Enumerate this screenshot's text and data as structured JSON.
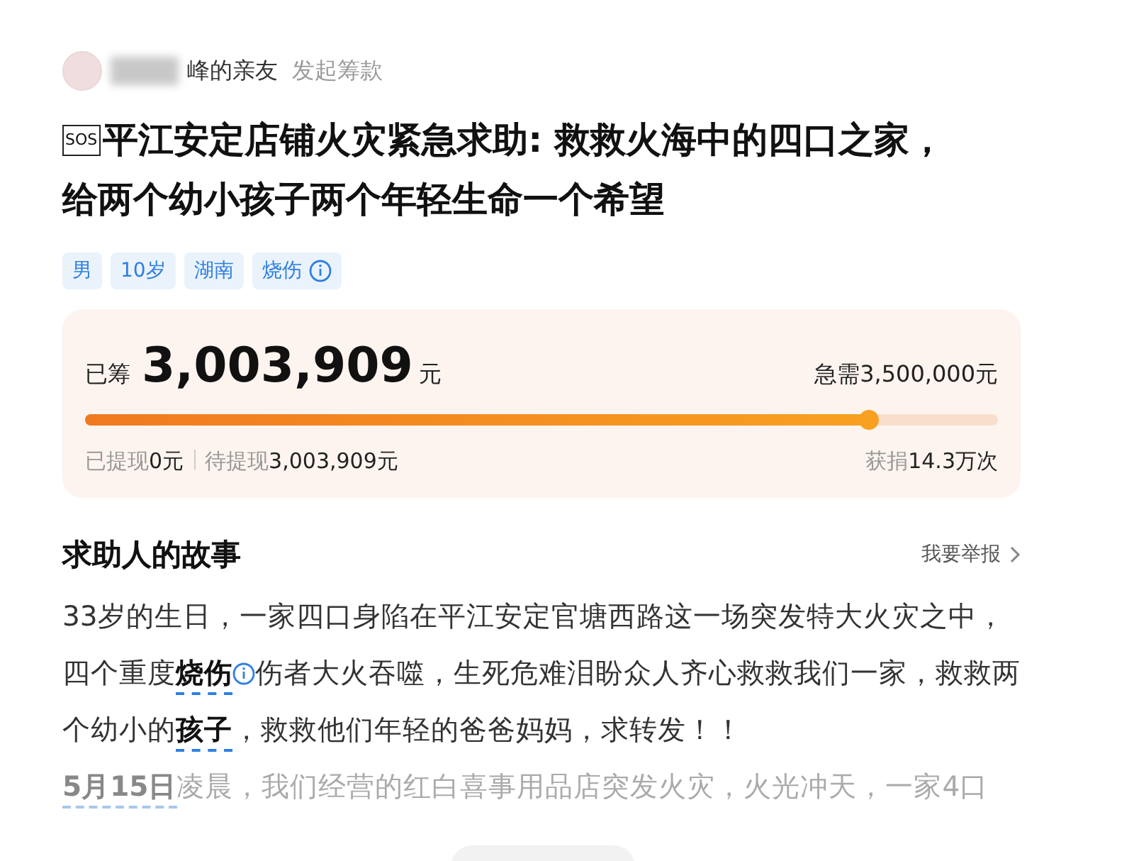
{
  "organizer": {
    "name": "峰的亲友",
    "action": "发起筹款"
  },
  "title": {
    "badge": "SOS",
    "text": "平江安定店铺火灾紧急求助: 救救火海中的四口之家，给两个幼小孩子两个年轻生命一个希望"
  },
  "tags": [
    {
      "label": "男",
      "info": false
    },
    {
      "label": "10岁",
      "info": false
    },
    {
      "label": "湖南",
      "info": false
    },
    {
      "label": "烧伤",
      "info": true
    }
  ],
  "funding": {
    "raised_label": "已筹",
    "raised": "3,003,909",
    "raised_unit": "元",
    "target": "急需3,500,000元",
    "level": 0.858,
    "withdrawn_label": "已提现",
    "withdrawn": "0元",
    "pending_label": "待提现",
    "pending": "3,003,909元",
    "donations_label": "获捐",
    "donations": "14.3万次"
  },
  "story": {
    "heading": "求助人的故事",
    "report": "我要举报",
    "paragraphs": [
      {
        "text": "33岁的生日，一家四口身陷在平江安定官塘西路这一场突发特大火灾之中，四个重度**烧伤**伤者大火吞噬，生死危难泪盼众人齐心救救我们一家，救救两个幼小的**孩子**，救救他们年轻的爸爸妈妈，求转发！！",
        "faded": false
      },
      {
        "text": "**5月15日**凌晨，我们经营的红白喜事用品店突发火灾，火光冲天，一家4口",
        "faded": true
      }
    ]
  }
}
